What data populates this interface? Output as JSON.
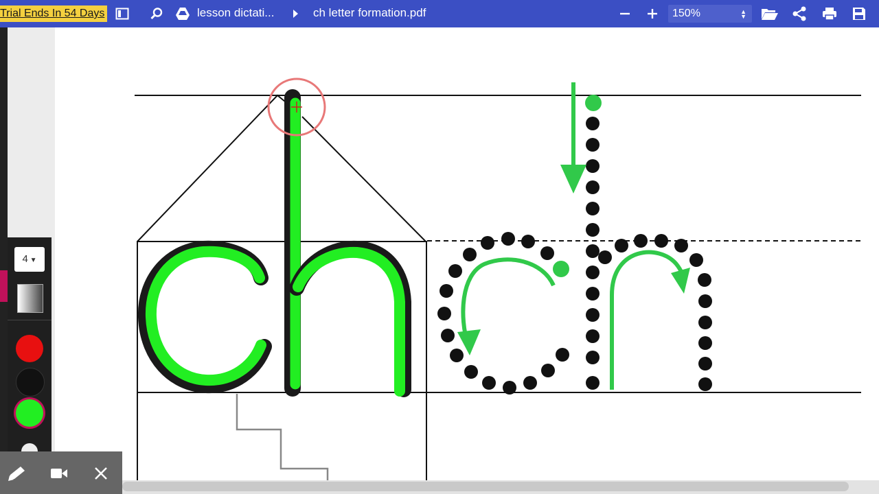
{
  "toolbar": {
    "trial_text": "Trial Ends In 54 Days",
    "breadcrumb_folder": "lesson dictati...",
    "file_name": "ch letter formation.pdf",
    "zoom_value": "150%",
    "zoom_out_icon": "minus-icon",
    "zoom_in_icon": "plus-icon",
    "sidebar_icon": "sidebar-toggle-icon",
    "search_icon": "search-icon",
    "drive_icon": "google-drive-icon",
    "chevron_icon": "chevron-right-icon",
    "open_icon": "folder-open-icon",
    "share_icon": "share-icon",
    "print_icon": "print-icon",
    "save_icon": "save-icon"
  },
  "pen_panel": {
    "size_value": "4",
    "colors": [
      "#e81010",
      "#111111",
      "#22ee22"
    ],
    "selected_color": "#22ee22"
  },
  "bottom_tools": {
    "pen_icon": "pen-icon",
    "camera_icon": "video-camera-icon",
    "close_icon": "close-icon"
  },
  "document": {
    "letters": "ch",
    "ink_color": "#31c94a"
  }
}
